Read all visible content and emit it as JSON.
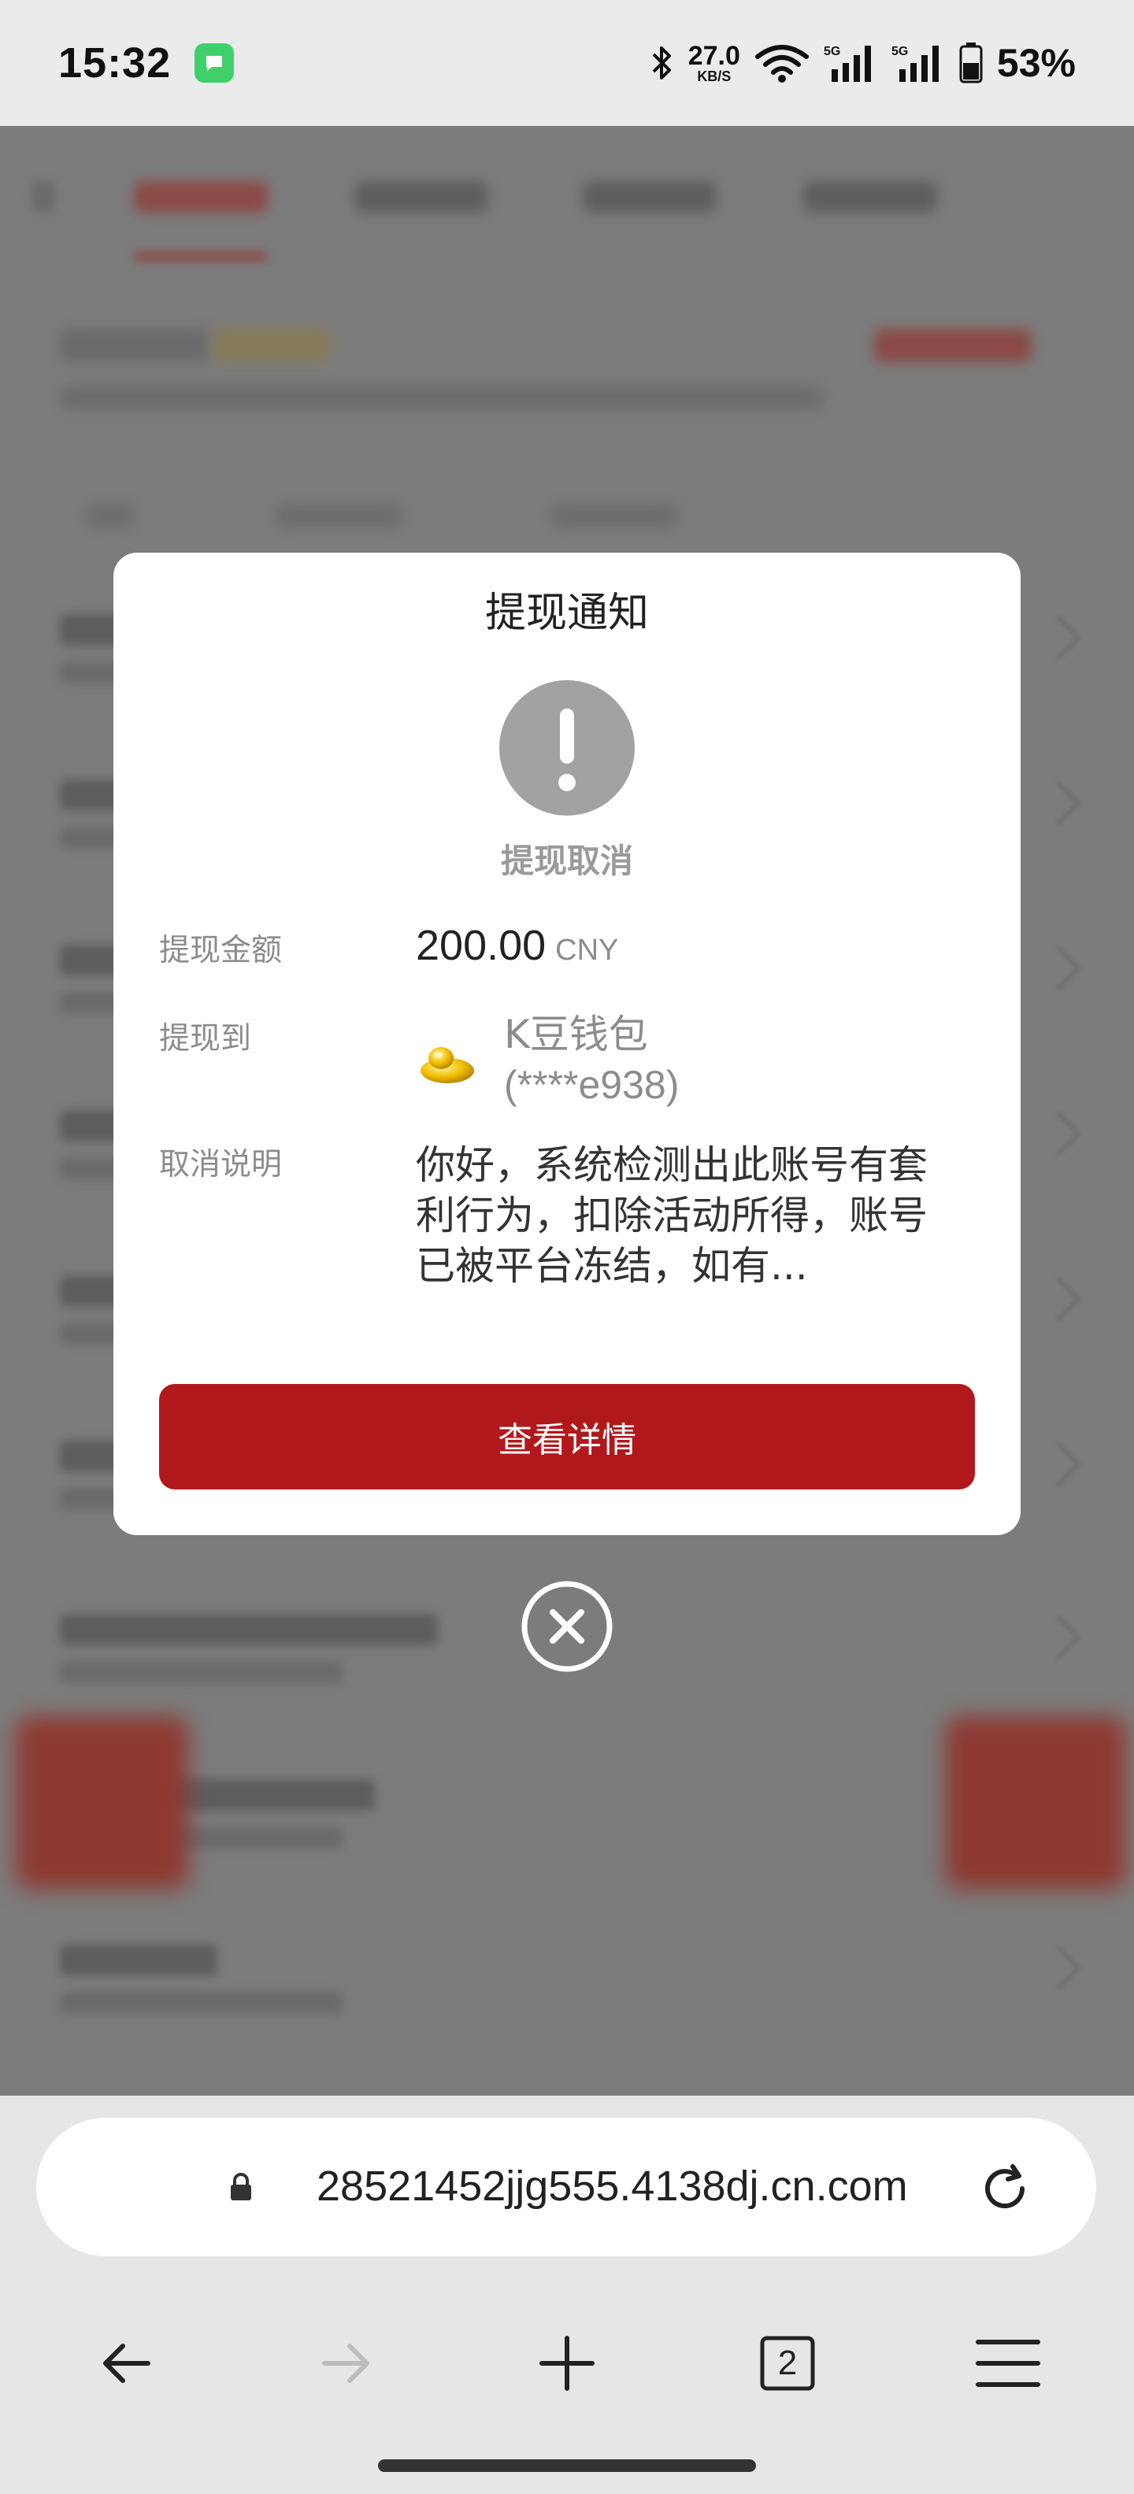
{
  "status_bar": {
    "time": "15:32",
    "net_speed_value": "27.0",
    "net_speed_unit": "KB/S",
    "battery_percent": "53%",
    "icons": [
      "messages-app-icon",
      "bluetooth-icon",
      "wifi-icon",
      "signal-5g-icon",
      "signal-5g-icon",
      "battery-icon"
    ]
  },
  "modal": {
    "title": "提现通知",
    "status_icon": "alert-exclamation-icon",
    "status_label": "提现取消",
    "amount_label": "提现金额",
    "amount_value": "200.00",
    "amount_currency": "CNY",
    "destination_label": "提现到",
    "wallet_icon": "gold-ingot-icon",
    "wallet_name": "K豆钱包",
    "wallet_account": "(****e938)",
    "cancel_label": "取消说明",
    "cancel_text": "你好，系统检测出此账号有套利行为，扣除活动所得，账号已被平台冻结，如有...",
    "detail_button": "查看详情",
    "close_icon": "close-circle-icon",
    "accent_color": "#b1181c"
  },
  "browser": {
    "url": "28521452jjg555.4138dj.cn.com",
    "open_tabs": "2",
    "icons": [
      "lock-icon",
      "reload-icon",
      "back-arrow-icon",
      "forward-arrow-icon",
      "new-tab-plus-icon",
      "tabs-icon",
      "menu-icon"
    ]
  }
}
